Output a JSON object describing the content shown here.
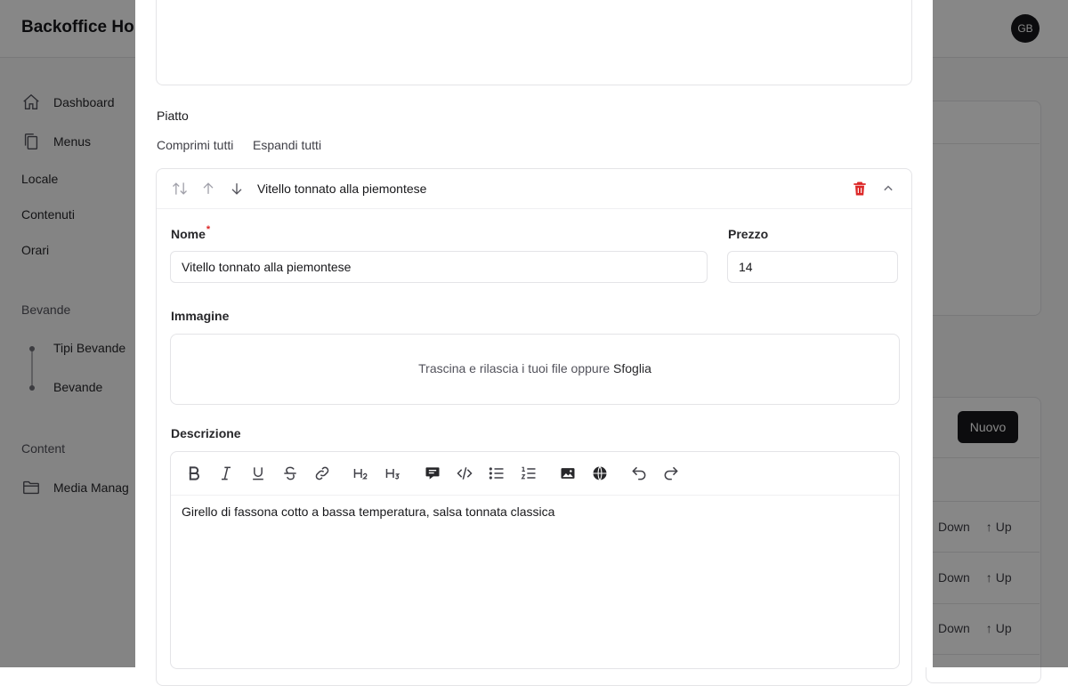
{
  "app": {
    "brand": "Backoffice Ho",
    "avatar_initials": "GB",
    "sidebar": {
      "items": [
        {
          "label": "Dashboard",
          "icon": "home-icon"
        },
        {
          "label": "Menus",
          "icon": "documents-icon"
        },
        {
          "label": "Locale"
        },
        {
          "label": "Contenuti"
        },
        {
          "label": "Orari"
        }
      ],
      "group_bevande": "Bevande",
      "bevande_items": [
        "Tipi Bevande",
        "Bevande"
      ],
      "group_content": "Content",
      "media_item": {
        "label": "Media Manag",
        "icon": "folder-icon"
      }
    },
    "new_button": "Nuovo",
    "rows": [
      {
        "down": "Down",
        "up": "Up"
      },
      {
        "down": "Down",
        "up": "Up"
      },
      {
        "down": "Down",
        "up": "Up"
      }
    ]
  },
  "modal": {
    "section_label": "Piatto",
    "collapse_all": "Comprimi tutti",
    "expand_all": "Espandi tutti",
    "item": {
      "title": "Vitello tonnato alla piemontese",
      "name_label": "Nome",
      "required_mark": "*",
      "name_value": "Vitello tonnato alla piemontese",
      "price_label": "Prezzo",
      "price_value": "14",
      "image_label": "Immagine",
      "dropzone_text": "Trascina e rilascia i tuoi file oppure",
      "dropzone_browse": "Sfoglia",
      "description_label": "Descrizione",
      "description_value": "Girello di fassona cotto a bassa temperatura, salsa tonnata classica"
    },
    "toolbar_icons": [
      "bold-icon",
      "italic-icon",
      "underline-icon",
      "strikethrough-icon",
      "link-icon",
      "heading2-icon",
      "heading3-icon",
      "blockquote-icon",
      "code-icon",
      "bullet-list-icon",
      "ordered-list-icon",
      "image-icon",
      "embed-icon",
      "undo-icon",
      "redo-icon"
    ],
    "colors": {
      "delete": "#dc2626",
      "overlay": "rgba(0,0,0,0.47)",
      "primary": "#18181b"
    }
  }
}
